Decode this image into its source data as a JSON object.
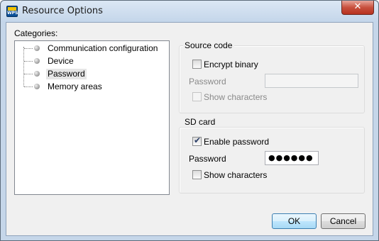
{
  "window": {
    "title": "Resource Options",
    "app_icon_text": "WPS",
    "close_glyph": "✕"
  },
  "categories": {
    "label": "Categories:",
    "items": [
      {
        "label": "Communication configuration",
        "selected": false
      },
      {
        "label": "Device",
        "selected": false
      },
      {
        "label": "Password",
        "selected": true
      },
      {
        "label": "Memory areas",
        "selected": false
      }
    ]
  },
  "source_code": {
    "title": "Source code",
    "encrypt_label": "Encrypt binary",
    "encrypt_checked": false,
    "password_label": "Password",
    "password_value": "",
    "show_chars_label": "Show characters",
    "show_chars_checked": false
  },
  "sd_card": {
    "title": "SD card",
    "enable_label": "Enable password",
    "enable_checked": true,
    "password_label": "Password",
    "password_value": "●●●●●●",
    "show_chars_label": "Show characters",
    "show_chars_checked": false
  },
  "buttons": {
    "ok": "OK",
    "cancel": "Cancel"
  },
  "icons": {
    "check": "✔"
  }
}
